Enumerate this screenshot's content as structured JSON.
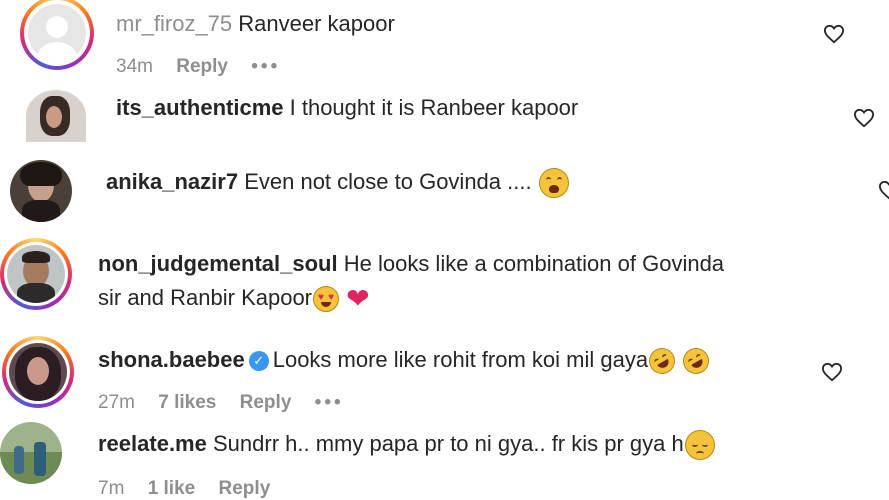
{
  "comments": [
    {
      "user": "mr_firoz_75",
      "text": "Ranveer kapoor",
      "time": "34m",
      "reply": "Reply",
      "more": "•••"
    },
    {
      "user": "its_authenticme",
      "text": "I thought it is Ranbeer kapoor"
    },
    {
      "user": "anika_nazir7",
      "text": "Even not close to Govinda ...."
    },
    {
      "user": "non_judgemental_soul",
      "text_line1": "He looks like a combination of Govinda",
      "text_line2": "sir and Ranbir Kapoor"
    },
    {
      "user": "shona.baebee",
      "text": "Looks more like rohit from koi mil gaya",
      "time": "27m",
      "likes": "7 likes",
      "reply": "Reply",
      "more": "•••"
    },
    {
      "user": "reelate.me",
      "text": "Sundrr h.. mmy papa pr to ni gya.. fr kis pr gya h",
      "time": "7m",
      "likes": "1 like",
      "reply": "Reply"
    }
  ],
  "colors": {
    "primary_text": "#262626",
    "secondary_text": "#8e8e8e",
    "verified": "#3897f0",
    "heart_red": "#e0245e"
  },
  "icons": [
    "heart-outline-icon",
    "verified-badge-icon",
    "emoji"
  ]
}
